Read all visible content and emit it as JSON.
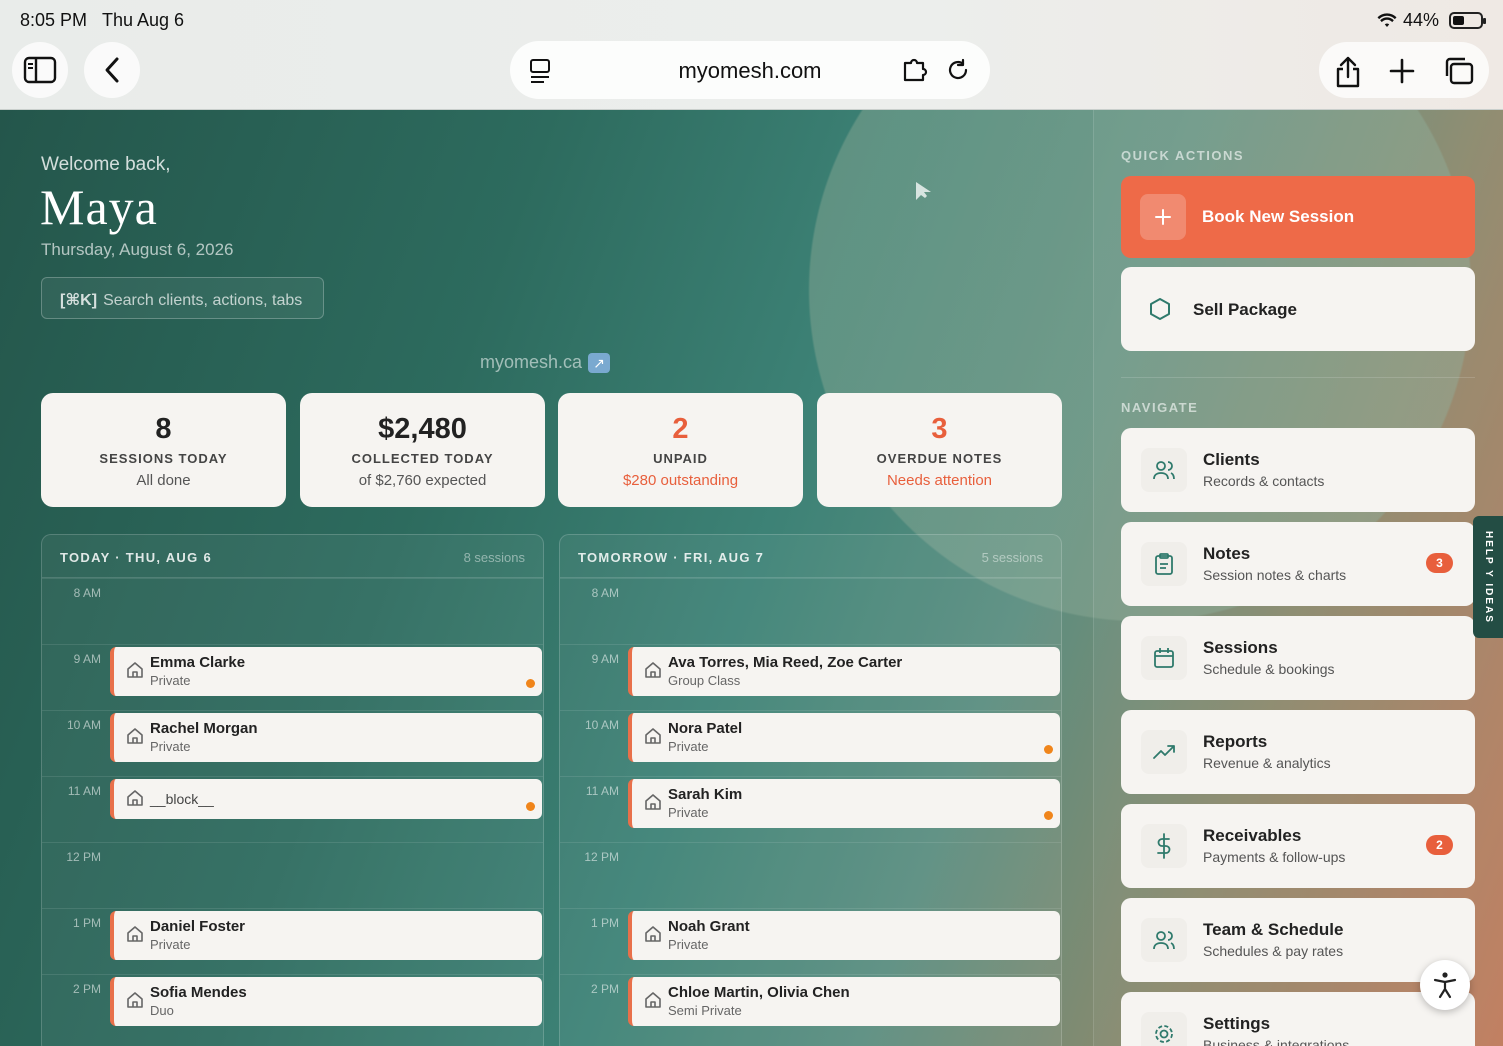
{
  "status_bar": {
    "time": "8:05 PM",
    "date": "Thu Aug 6",
    "battery": "44%",
    "battery_level": 0.44
  },
  "browser": {
    "url": "myomesh.com"
  },
  "header": {
    "welcome": "Welcome back,",
    "name": "Maya",
    "date": "Thursday, August 6, 2026",
    "search_shortcut": "[⌘K]",
    "search_placeholder": "Search clients, actions, tabs",
    "site_link": "myomesh.ca"
  },
  "stats": [
    {
      "value": "8",
      "label": "SESSIONS TODAY",
      "sub": "All done"
    },
    {
      "value": "$2,480",
      "label": "COLLECTED TODAY",
      "sub": "of $2,760 expected"
    },
    {
      "value": "2",
      "label": "UNPAID",
      "sub": "$280 outstanding"
    },
    {
      "value": "3",
      "label": "OVERDUE NOTES",
      "sub": "Needs attention"
    }
  ],
  "today": {
    "title": "TODAY · THU, AUG 6",
    "count": "8 sessions",
    "hours": [
      "8 AM",
      "9 AM",
      "10 AM",
      "11 AM",
      "12 PM",
      "1 PM",
      "2 PM"
    ],
    "events": [
      {
        "name": "Emma Clarke",
        "type": "Private"
      },
      {
        "name": "Rachel Morgan",
        "type": "Private"
      },
      {
        "name": "__block__",
        "type": ""
      },
      {
        "name": "Daniel Foster",
        "type": "Private"
      },
      {
        "name": "Sofia Mendes",
        "type": "Duo"
      }
    ]
  },
  "tomorrow": {
    "title": "TOMORROW · FRI, AUG 7",
    "count": "5 sessions",
    "hours": [
      "8 AM",
      "9 AM",
      "10 AM",
      "11 AM",
      "12 PM",
      "1 PM",
      "2 PM"
    ],
    "events": [
      {
        "name": "Ava Torres, Mia Reed, Zoe Carter",
        "type": "Group Class"
      },
      {
        "name": "Nora Patel",
        "type": "Private"
      },
      {
        "name": "Sarah Kim",
        "type": "Private"
      },
      {
        "name": "Noah Grant",
        "type": "Private"
      },
      {
        "name": "Chloe Martin, Olivia Chen",
        "type": "Semi Private"
      }
    ]
  },
  "sidebar": {
    "quick_actions_label": "QUICK ACTIONS",
    "book_label": "Book New Session",
    "sell_label": "Sell Package",
    "navigate_label": "NAVIGATE",
    "nav": [
      {
        "title": "Clients",
        "sub": "Records & contacts",
        "icon": "users-icon"
      },
      {
        "title": "Notes",
        "sub": "Session notes & charts",
        "icon": "clipboard-icon",
        "badge": "3"
      },
      {
        "title": "Sessions",
        "sub": "Schedule & bookings",
        "icon": "calendar-icon"
      },
      {
        "title": "Reports",
        "sub": "Revenue & analytics",
        "icon": "trend-icon"
      },
      {
        "title": "Receivables",
        "sub": "Payments & follow-ups",
        "icon": "dollar-icon",
        "badge": "2"
      },
      {
        "title": "Team & Schedule",
        "sub": "Schedules & pay rates",
        "icon": "users-icon"
      },
      {
        "title": "Settings",
        "sub": "Business & integrations",
        "icon": "gear-icon"
      }
    ],
    "help_tab": "HELP Y IDEAS"
  },
  "colors": {
    "accent": "#ee6a48",
    "teal": "#2d6b5e",
    "alert": "#e85f3c",
    "dot": "#f0851b"
  }
}
